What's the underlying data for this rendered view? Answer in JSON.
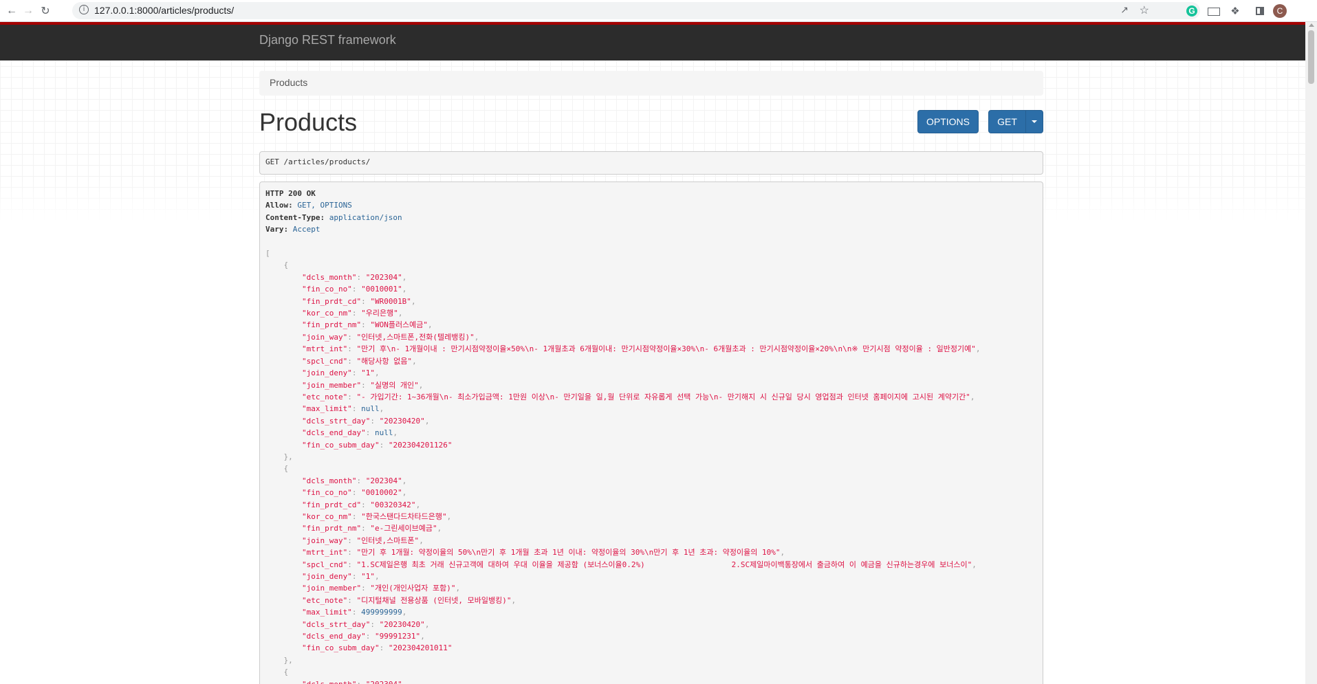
{
  "browser": {
    "url": "127.0.0.1:8000/articles/products/",
    "avatar_letter": "C"
  },
  "navbar": {
    "brand": "Django REST framework"
  },
  "breadcrumb": {
    "current": "Products"
  },
  "page_title": "Products",
  "buttons": {
    "options": "OPTIONS",
    "get": "GET"
  },
  "request": {
    "method": "GET",
    "path": "/articles/products/"
  },
  "response": {
    "status": "HTTP 200 OK",
    "headers": [
      {
        "key": "Allow:",
        "value": "GET, OPTIONS"
      },
      {
        "key": "Content-Type:",
        "value": "application/json"
      },
      {
        "key": "Vary:",
        "value": "Accept"
      }
    ]
  },
  "products": [
    [
      [
        "dcls_month",
        "str",
        "202304"
      ],
      [
        "fin_co_no",
        "str",
        "0010001"
      ],
      [
        "fin_prdt_cd",
        "str",
        "WR0001B"
      ],
      [
        "kor_co_nm",
        "str",
        "우리은행"
      ],
      [
        "fin_prdt_nm",
        "str",
        "WON플러스예금"
      ],
      [
        "join_way",
        "str",
        "인터넷,스마트폰,전화(텔레뱅킹)"
      ],
      [
        "mtrt_int",
        "str",
        "만기 후\\n- 1개월이내 : 만기시점약정이율×50%\\n- 1개월초과 6개월이내: 만기시점약정이율×30%\\n- 6개월초과 : 만기시점약정이율×20%\\n\\n※ 만기시점 약정이율 : 일반정기예"
      ],
      [
        "spcl_cnd",
        "str",
        "해당사항 없음"
      ],
      [
        "join_deny",
        "str",
        "1"
      ],
      [
        "join_member",
        "str",
        "실명의 개인"
      ],
      [
        "etc_note",
        "str",
        "- 가입기간: 1~36개월\\n- 최소가입금액: 1만원 이상\\n- 만기일을 일,월 단위로 자유롭게 선택 가능\\n- 만기해지 시 신규일 당시 영업점과 인터넷 홈페이지에 고시된 계약기간"
      ],
      [
        "max_limit",
        "null",
        "null"
      ],
      [
        "dcls_strt_day",
        "str",
        "20230420"
      ],
      [
        "dcls_end_day",
        "null",
        "null"
      ],
      [
        "fin_co_subm_day",
        "str",
        "202304201126"
      ]
    ],
    [
      [
        "dcls_month",
        "str",
        "202304"
      ],
      [
        "fin_co_no",
        "str",
        "0010002"
      ],
      [
        "fin_prdt_cd",
        "str",
        "00320342"
      ],
      [
        "kor_co_nm",
        "str",
        "한국스탠다드차타드은행"
      ],
      [
        "fin_prdt_nm",
        "str",
        "e-그린세이브예금"
      ],
      [
        "join_way",
        "str",
        "인터넷,스마트폰"
      ],
      [
        "mtrt_int",
        "str",
        "만기 후 1개월: 약정이율의 50%\\n만기 후 1개월 초과 1년 이내: 약정이율의 30%\\n만기 후 1년 초과: 약정이율의 10%"
      ],
      [
        "spcl_cnd",
        "str",
        "1.SC제일은행 최초 거래 신규고객에 대하여 우대 이율을 제공함 (보너스이율0.2%)                   2.SC제일마이백통장에서 출금하여 이 예금을 신규하는경우에 보너스이"
      ],
      [
        "join_deny",
        "str",
        "1"
      ],
      [
        "join_member",
        "str",
        "개인(개인사업자 포함)"
      ],
      [
        "etc_note",
        "str",
        "디지털채널 전용상품 (인터넷, 모바일뱅킹)"
      ],
      [
        "max_limit",
        "num",
        "499999999"
      ],
      [
        "dcls_strt_day",
        "str",
        "20230420"
      ],
      [
        "dcls_end_day",
        "str",
        "99991231"
      ],
      [
        "fin_co_subm_day",
        "str",
        "202304201011"
      ]
    ],
    [
      [
        "dcls_month",
        "str",
        "202304"
      ]
    ]
  ],
  "colors": {
    "navbar_bg": "#2c2c2c",
    "navbar_accent": "#a30000",
    "button_bg": "#2c6ea8",
    "json_string": "#dd1144",
    "json_literal": "#2a6496"
  },
  "icons": [
    "back-arrow-icon",
    "forward-arrow-icon",
    "reload-icon",
    "info-icon",
    "share-icon",
    "star-icon",
    "grammarly-icon",
    "extension-box-icon",
    "puzzle-icon",
    "side-panel-icon",
    "caret-down-icon"
  ]
}
